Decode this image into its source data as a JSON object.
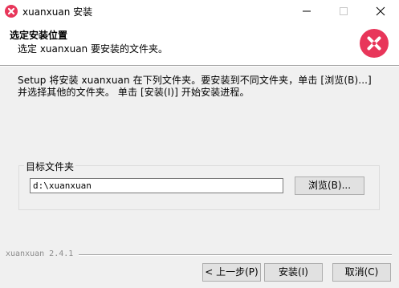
{
  "window": {
    "title": "xuanxuan 安装",
    "app_icon": "xuanxuan-logo-icon",
    "brand_color": "#e8365a"
  },
  "header": {
    "title": "选定安装位置",
    "subtitle": "选定 xuanxuan 要安装的文件夹。",
    "logo": "xuanxuan-logo-icon"
  },
  "description": {
    "line1": "Setup 将安装 xuanxuan 在下列文件夹。要安装到不同文件夹，单击 [浏览(B)...]",
    "line2": "并选择其他的文件夹。 单击 [安装(I)] 开始安装进程。"
  },
  "destination": {
    "group_label": "目标文件夹",
    "path_value": "d:\\xuanxuan",
    "browse_label": "浏览(B)..."
  },
  "footer": {
    "brand_text": "xuanxuan 2.4.1",
    "back_label": "< 上一步(P)",
    "install_label": "安装(I)",
    "cancel_label": "取消(C)"
  }
}
